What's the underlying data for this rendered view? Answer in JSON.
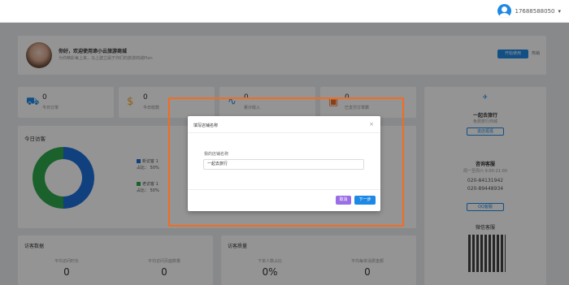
{
  "header": {
    "username": "17688588050",
    "dropdown_icon": "chevron-down-icon"
  },
  "welcome": {
    "greeting": "你好，欢迎使用谛小云旅游商城",
    "subtitle": "为你精彩每上来，马上建立属于你们的旅游商城Plan",
    "open_button": "开始使用",
    "open_desc": "热销"
  },
  "stats": [
    {
      "icon": "cart-icon",
      "value": "0",
      "label": "今日订单"
    },
    {
      "icon": "dollar-icon",
      "value": "0",
      "label": "今日收款"
    },
    {
      "icon": "trend-icon",
      "value": "0",
      "label": "累计收入"
    },
    {
      "icon": "wallet-icon",
      "value": "0",
      "label": "已支付订单数"
    }
  ],
  "visitors": {
    "title": "今日访客",
    "legend": [
      {
        "name": "新访客",
        "count": "1",
        "pct": "占比： 50%",
        "color": "#1e6fd9"
      },
      {
        "name": "老访客",
        "count": "1",
        "pct": "占比： 50%",
        "color": "#2ea84b"
      }
    ]
  },
  "right_panel": {
    "shop_name": "一起去旅行",
    "shop_sub": "免费旅行商城",
    "visit_button": "进店逛逛",
    "service_title": "咨询客服",
    "service_hours": "周一至周六 9:00-21:00",
    "phone1": "020-84131942",
    "phone2": "020-89448934",
    "qq_button": "QQ客服",
    "wechat_title": "微信客服"
  },
  "bottom_left": {
    "title": "访客数据",
    "cols": [
      {
        "label": "平均访问时长",
        "value": "0"
      },
      {
        "label": "平均访问页面数量",
        "value": "0"
      }
    ]
  },
  "bottom_right": {
    "title": "访客质量",
    "cols": [
      {
        "label": "下单人数占比",
        "value": "0%"
      },
      {
        "label": "平均每单消费金额",
        "value": "0"
      }
    ]
  },
  "dialog": {
    "title": "填写店铺名称",
    "field_label": "我的店铺名称",
    "field_value": "一起去旅行",
    "cancel": "取消",
    "next": "下一步",
    "close_icon": "close-icon"
  },
  "colors": {
    "accent": "#1e88e5",
    "cancel": "#9b6ee6",
    "highlight": "#f36c21"
  }
}
